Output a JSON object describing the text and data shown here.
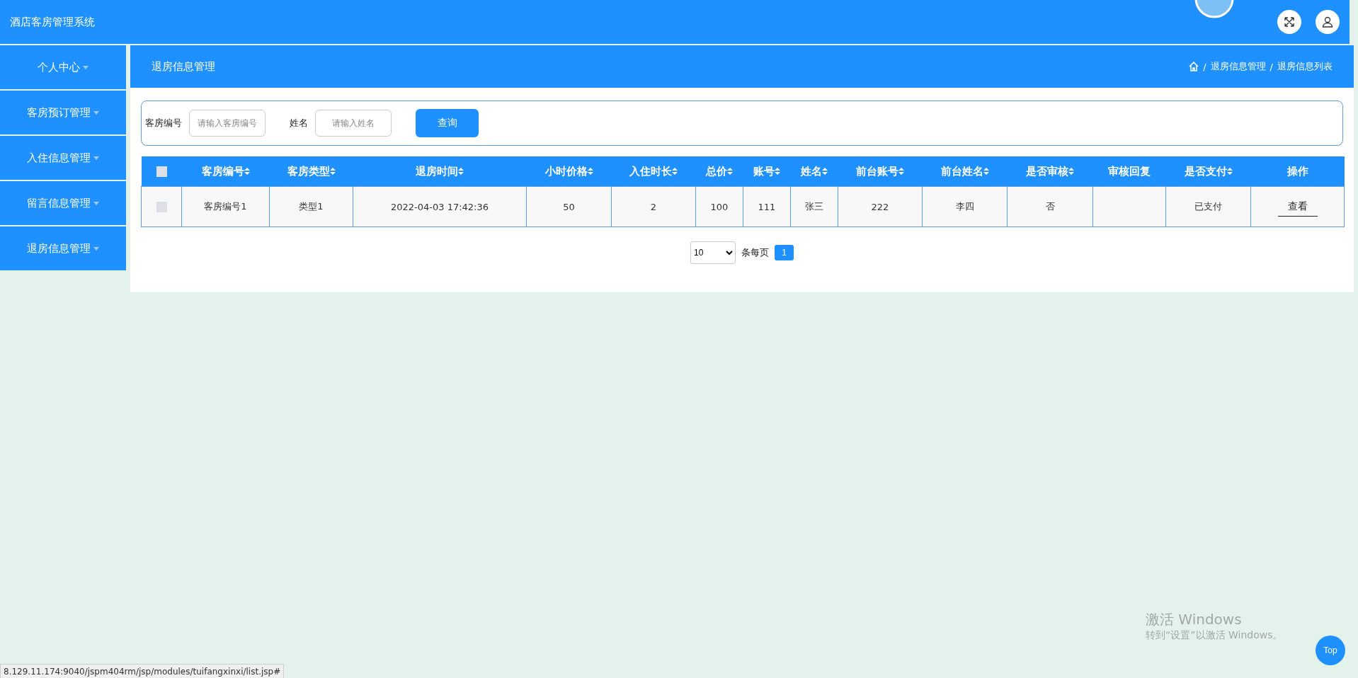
{
  "header": {
    "title": "酒店客房管理系统"
  },
  "sidebar": {
    "items": [
      {
        "label": "个人中心"
      },
      {
        "label": "客房预订管理"
      },
      {
        "label": "入住信息管理"
      },
      {
        "label": "留言信息管理"
      },
      {
        "label": "退房信息管理"
      }
    ]
  },
  "page_title": "退房信息管理",
  "breadcrumb": {
    "separator": "/",
    "items": [
      "退房信息管理",
      "退房信息列表"
    ]
  },
  "search": {
    "fields": [
      {
        "label": "客房编号",
        "placeholder": "请输入客房编号"
      },
      {
        "label": "姓名",
        "placeholder": "请输入姓名"
      }
    ],
    "button": "查询"
  },
  "table": {
    "select_all_checked": false,
    "columns": [
      {
        "label": "客房编号",
        "sortable": true
      },
      {
        "label": "客房类型",
        "sortable": true
      },
      {
        "label": "退房时间",
        "sortable": true
      },
      {
        "label": "小时价格",
        "sortable": true
      },
      {
        "label": "入住时长",
        "sortable": true
      },
      {
        "label": "总价",
        "sortable": true
      },
      {
        "label": "账号",
        "sortable": true
      },
      {
        "label": "姓名",
        "sortable": true
      },
      {
        "label": "前台账号",
        "sortable": true
      },
      {
        "label": "前台姓名",
        "sortable": true
      },
      {
        "label": "是否审核",
        "sortable": true
      },
      {
        "label": "审核回复",
        "sortable": false
      },
      {
        "label": "是否支付",
        "sortable": true
      },
      {
        "label": "操作",
        "sortable": false
      }
    ],
    "rows": [
      {
        "checked": false,
        "cells": [
          "客房编号1",
          "类型1",
          "2022-04-03 17:42:36",
          "50",
          "2",
          "100",
          "111",
          "张三",
          "222",
          "李四",
          "否",
          "",
          "已支付"
        ],
        "action": "查看"
      }
    ]
  },
  "pagination": {
    "page_size": "10",
    "page_size_label": "条每页",
    "pages": [
      {
        "label": "1",
        "selected": true
      }
    ]
  },
  "activation_notice": {
    "title": "激活 Windows",
    "text": "转到“设置”以激活 Windows。"
  },
  "top_button": "Top",
  "status_url": "8.129.11.174:9040/jspm404rm/jsp/modules/tuifangxinxi/list.jsp#"
}
